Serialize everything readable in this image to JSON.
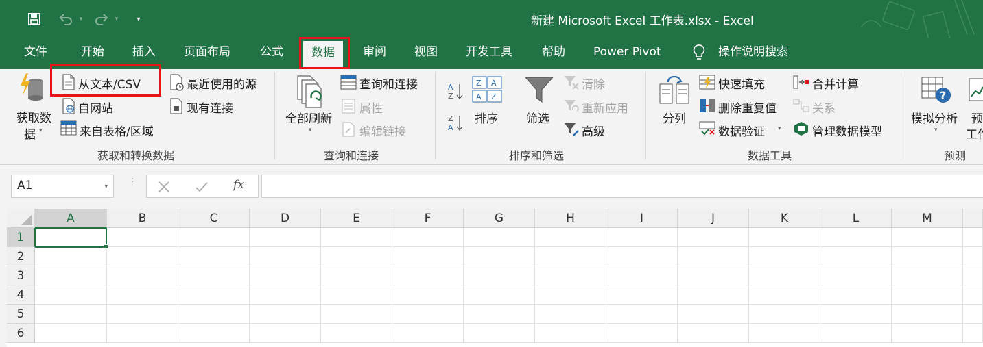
{
  "window": {
    "title": "新建 Microsoft Excel 工作表.xlsx  -  Excel"
  },
  "quick_access": {
    "icons": [
      "save-icon",
      "undo-icon",
      "redo-icon",
      "customize-icon"
    ]
  },
  "tabs": [
    "文件",
    "开始",
    "插入",
    "页面布局",
    "公式",
    "数据",
    "审阅",
    "视图",
    "开发工具",
    "帮助",
    "Power Pivot",
    "操作说明搜索"
  ],
  "active_tab": "数据",
  "ribbon": {
    "get_transform": {
      "get_data": "获取数\n据",
      "get_data_line1": "获取数",
      "get_data_line2": "据",
      "from_text_csv": "从文本/CSV",
      "from_web": "自网站",
      "from_table": "来自表格/区域",
      "recent_sources": "最近使用的源",
      "existing_connections": "现有连接",
      "label": "获取和转换数据"
    },
    "queries": {
      "refresh_all": "全部刷新",
      "queries_connections": "查询和连接",
      "properties": "属性",
      "edit_links": "编辑链接",
      "label": "查询和连接"
    },
    "sort_filter": {
      "sort": "排序",
      "filter": "筛选",
      "clear": "清除",
      "reapply": "重新应用",
      "advanced": "高级",
      "label": "排序和筛选"
    },
    "data_tools": {
      "text_to_columns": "分列",
      "flash_fill": "快速填充",
      "remove_duplicates": "删除重复值",
      "data_validation": "数据验证",
      "consolidate": "合并计算",
      "relationships": "关系",
      "manage_data_model": "管理数据模型",
      "label": "数据工具"
    },
    "forecast": {
      "what_if": "模拟分析",
      "forecast_sheet_line1": "预",
      "forecast_sheet_line2": "工作",
      "label": "预测"
    }
  },
  "formula_bar": {
    "name_box": "A1",
    "fx": "fx",
    "value": ""
  },
  "sheet": {
    "columns": [
      "A",
      "B",
      "C",
      "D",
      "E",
      "F",
      "G",
      "H",
      "I",
      "J",
      "K",
      "L",
      "M"
    ],
    "rows": [
      "1",
      "2",
      "3",
      "4",
      "5",
      "6"
    ],
    "active_cell": "A1"
  },
  "colors": {
    "accent": "#217346",
    "highlight_box": "#e8141b"
  }
}
